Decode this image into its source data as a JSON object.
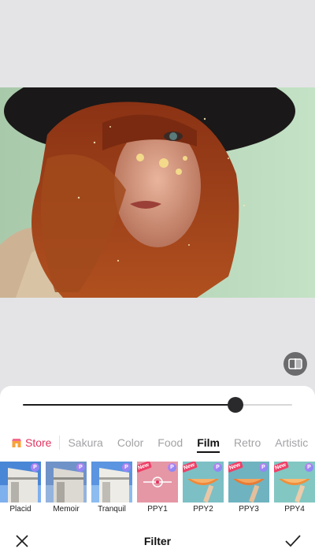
{
  "photo": {
    "description_icon": "portrait-photo"
  },
  "compare": {
    "icon": "compare-icon"
  },
  "slider": {
    "value": 0.79
  },
  "tabs": {
    "store_label": "Store",
    "items": [
      "Sakura",
      "Color",
      "Food",
      "Film",
      "Retro",
      "Artistic"
    ],
    "active": "Film"
  },
  "filters": [
    {
      "name": "Placid",
      "badge_new": false
    },
    {
      "name": "Memoir",
      "badge_new": false
    },
    {
      "name": "Tranquil",
      "badge_new": false
    },
    {
      "name": "PPY1",
      "badge_new": true
    },
    {
      "name": "PPY2",
      "badge_new": true
    },
    {
      "name": "PPY3",
      "badge_new": true
    },
    {
      "name": "PPY4",
      "badge_new": true
    }
  ],
  "badges": {
    "new_label": "New",
    "premium_label": "P"
  },
  "bottom_bar": {
    "title": "Filter",
    "cancel_icon": "close-icon",
    "confirm_icon": "checkmark-icon"
  },
  "colors": {
    "accent": "#e2325e",
    "new_badge": "#ef3f67",
    "active_tab": "#111111"
  }
}
